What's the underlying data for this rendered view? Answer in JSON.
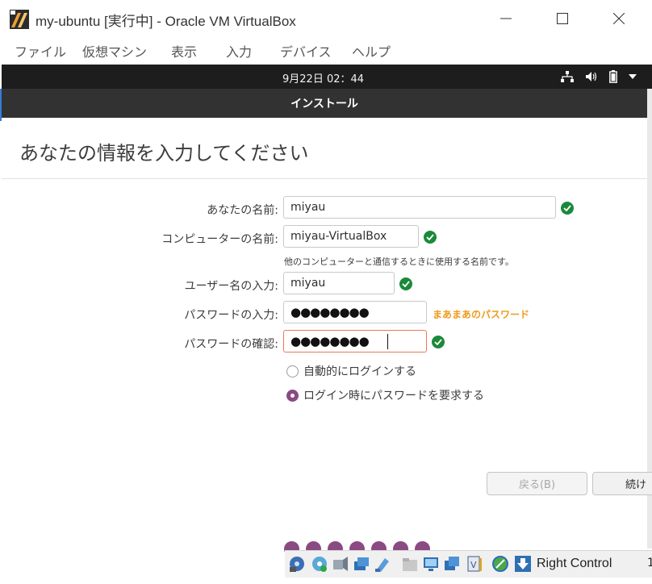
{
  "window": {
    "title": "my-ubuntu [実行中] - Oracle VM VirtualBox",
    "menu": [
      "ファイル",
      "仮想マシン",
      "表示",
      "入力",
      "デバイス",
      "ヘルプ"
    ]
  },
  "guest_topbar": {
    "clock": "9月22日  02：44",
    "tray_icons": [
      "network-icon",
      "volume-icon",
      "battery-icon",
      "dropdown-arrow-icon"
    ]
  },
  "installer": {
    "header_title": "インストール",
    "page_heading": "あなたの情報を入力してください",
    "fields": {
      "your_name": {
        "label": "あなたの名前:",
        "value": "miyau"
      },
      "computer_name": {
        "label": "コンピューターの名前:",
        "value": "miyau-VirtualBox",
        "hint": "他のコンピューターと通信するときに使用する名前です。"
      },
      "username": {
        "label": "ユーザー名の入力:",
        "value": "miyau"
      },
      "password": {
        "label": "パスワードの入力:",
        "masked": "●●●●●●●●",
        "strength": "まあまあのパスワード"
      },
      "password_confirm": {
        "label": "パスワードの確認:",
        "masked": "●●●●●●●●"
      }
    },
    "login_options": [
      {
        "label": "自動的にログインする",
        "selected": false
      },
      {
        "label": "ログイン時にパスワードを要求する",
        "selected": true
      }
    ],
    "buttons": {
      "back": "戻る(B)",
      "continue": "続け"
    },
    "progress_steps": 7
  },
  "statusbar": {
    "host_key": "Right Control",
    "icons": [
      "hard-disk-icon",
      "optical-disk-icon",
      "audio-icon",
      "network-adapter-icon",
      "usb-icon",
      "shared-folder-icon",
      "display-icon",
      "video-capture-icon",
      "virtualization-icon",
      "mouse-integration-icon",
      "host-key-arrow-icon"
    ]
  },
  "colors": {
    "ubuntu_purple": "#8a4a82",
    "check_green": "#1a8a3a",
    "strength_orange": "#f09a1a",
    "focus_border": "#e9795a"
  }
}
